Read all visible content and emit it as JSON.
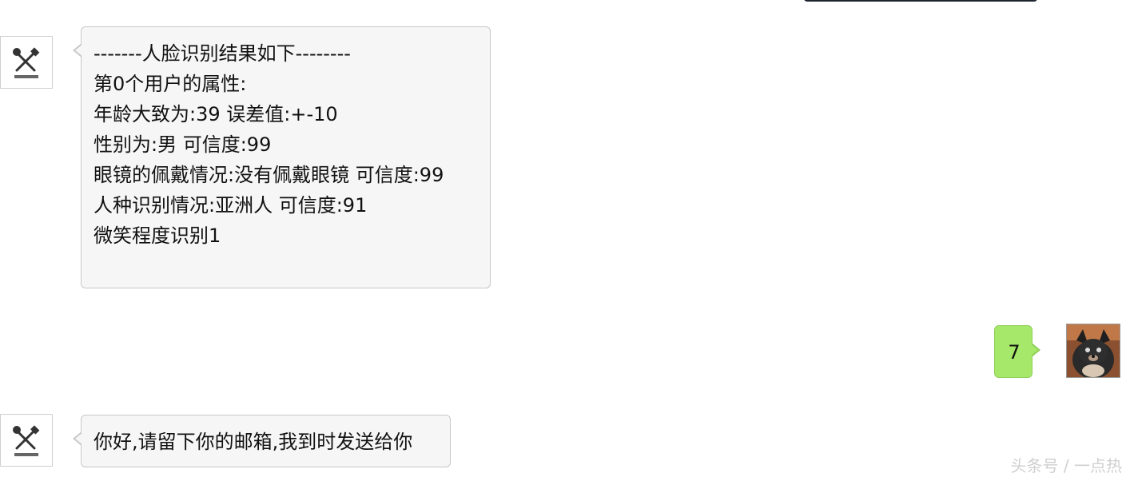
{
  "chat": {
    "messages": [
      {
        "sender": "bot",
        "lines": [
          "-------人脸识别结果如下--------",
          "第0个用户的属性:",
          "年龄大致为:39   误差值:+-10",
          "性别为:男   可信度:99",
          "眼镜的佩戴情况:没有佩戴眼镜   可信度:99",
          "人种识别情况:亚洲人   可信度:91",
          "微笑程度识别1"
        ]
      },
      {
        "sender": "user",
        "text": "7"
      },
      {
        "sender": "bot",
        "text": "你好,请留下你的邮箱,我到时发送给你"
      }
    ]
  },
  "watermark": "头条号 / 一点热",
  "colors": {
    "bot_bubble": "#f6f6f6",
    "user_bubble": "#a6e86a",
    "bubble_border": "#c8c8c8"
  },
  "icons": {
    "bot_avatar": "tools-logo-icon",
    "user_avatar": "dog-photo-avatar"
  }
}
